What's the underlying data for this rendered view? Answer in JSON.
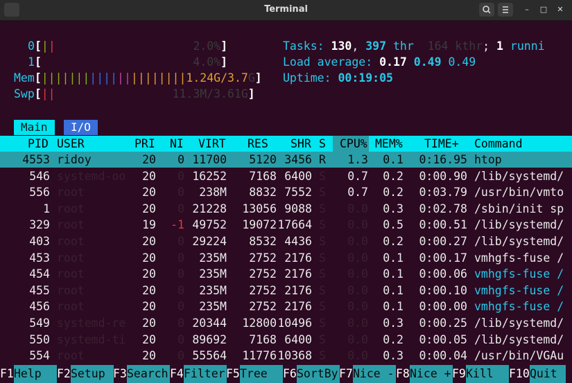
{
  "window": {
    "title": "Terminal"
  },
  "meters": {
    "cpu0": {
      "label": "0",
      "value": "2.0%"
    },
    "cpu1": {
      "label": "1",
      "value": "4.0%"
    },
    "mem": {
      "label": "Mem",
      "value": "1.24G/3.7",
      "value_tail": "G"
    },
    "swp": {
      "label": "Swp",
      "value": "11.3M/3.61G"
    }
  },
  "info": {
    "tasks_label": "Tasks:",
    "tasks": "130",
    "thr": "397",
    "thr_label": "thr",
    "kthr": "164 kthr",
    "running": "1",
    "running_label": "runni",
    "load_label": "Load average:",
    "load1": "0.17",
    "load5": "0.49",
    "load15": "0.49",
    "uptime_label": "Uptime:",
    "uptime": "00:19:05"
  },
  "tabs": [
    "Main",
    "I/O"
  ],
  "columns": [
    "PID",
    "USER",
    "PRI",
    "NI",
    "VIRT",
    "RES",
    "SHR",
    "S",
    "CPU%",
    "MEM%",
    "TIME+",
    "Command"
  ],
  "processes": [
    {
      "pid": "4553",
      "user": "ridoy",
      "pri": "20",
      "ni": "0",
      "virt": "11700",
      "res": "5120",
      "shr": "3456",
      "s": "R",
      "cpu": "1.3",
      "mem": "0.1",
      "time": "0:16.95",
      "cmd": "htop"
    },
    {
      "pid": "546",
      "user": "systemd-oo",
      "pri": "20",
      "ni": "0",
      "virt": "16252",
      "res": "7168",
      "shr": "6400",
      "s": "S",
      "cpu": "0.7",
      "mem": "0.2",
      "time": "0:00.90",
      "cmd": "/lib/systemd/"
    },
    {
      "pid": "556",
      "user": "root",
      "pri": "20",
      "ni": "0",
      "virt": "238M",
      "res": "8832",
      "shr": "7552",
      "s": "S",
      "cpu": "0.7",
      "mem": "0.2",
      "time": "0:03.79",
      "cmd": "/usr/bin/vmto"
    },
    {
      "pid": "1",
      "user": "root",
      "pri": "20",
      "ni": "0",
      "virt": "21228",
      "res": "13056",
      "shr": "9088",
      "s": "S",
      "cpu": "0.0",
      "mem": "0.3",
      "time": "0:02.78",
      "cmd": "/sbin/init sp"
    },
    {
      "pid": "329",
      "user": "root",
      "pri": "19",
      "ni": "-1",
      "virt": "49752",
      "res": "19072",
      "shr": "17664",
      "s": "S",
      "cpu": "0.0",
      "mem": "0.5",
      "time": "0:00.51",
      "cmd": "/lib/systemd/"
    },
    {
      "pid": "403",
      "user": "root",
      "pri": "20",
      "ni": "0",
      "virt": "29224",
      "res": "8532",
      "shr": "4436",
      "s": "S",
      "cpu": "0.0",
      "mem": "0.2",
      "time": "0:00.27",
      "cmd": "/lib/systemd/"
    },
    {
      "pid": "453",
      "user": "root",
      "pri": "20",
      "ni": "0",
      "virt": "235M",
      "res": "2752",
      "shr": "2176",
      "s": "S",
      "cpu": "0.0",
      "mem": "0.1",
      "time": "0:00.17",
      "cmd": "vmhgfs-fuse /"
    },
    {
      "pid": "454",
      "user": "root",
      "pri": "20",
      "ni": "0",
      "virt": "235M",
      "res": "2752",
      "shr": "2176",
      "s": "S",
      "cpu": "0.0",
      "mem": "0.1",
      "time": "0:00.06",
      "cmd": "vmhgfs-fuse /"
    },
    {
      "pid": "455",
      "user": "root",
      "pri": "20",
      "ni": "0",
      "virt": "235M",
      "res": "2752",
      "shr": "2176",
      "s": "S",
      "cpu": "0.0",
      "mem": "0.1",
      "time": "0:00.10",
      "cmd": "vmhgfs-fuse /"
    },
    {
      "pid": "456",
      "user": "root",
      "pri": "20",
      "ni": "0",
      "virt": "235M",
      "res": "2752",
      "shr": "2176",
      "s": "S",
      "cpu": "0.0",
      "mem": "0.1",
      "time": "0:00.00",
      "cmd": "vmhgfs-fuse /"
    },
    {
      "pid": "549",
      "user": "systemd-re",
      "pri": "20",
      "ni": "0",
      "virt": "20344",
      "res": "12800",
      "shr": "10496",
      "s": "S",
      "cpu": "0.0",
      "mem": "0.3",
      "time": "0:00.25",
      "cmd": "/lib/systemd/"
    },
    {
      "pid": "550",
      "user": "systemd-ti",
      "pri": "20",
      "ni": "0",
      "virt": "89692",
      "res": "7168",
      "shr": "6400",
      "s": "S",
      "cpu": "0.0",
      "mem": "0.2",
      "time": "0:00.05",
      "cmd": "/lib/systemd/"
    },
    {
      "pid": "554",
      "user": "root",
      "pri": "20",
      "ni": "0",
      "virt": "55564",
      "res": "11776",
      "shr": "10368",
      "s": "S",
      "cpu": "0.0",
      "mem": "0.3",
      "time": "0:00.04",
      "cmd": "/usr/bin/VGAu"
    }
  ],
  "footer": [
    {
      "key": "F1",
      "label": "Help"
    },
    {
      "key": "F2",
      "label": "Setup"
    },
    {
      "key": "F3",
      "label": "Search"
    },
    {
      "key": "F4",
      "label": "Filter"
    },
    {
      "key": "F5",
      "label": "Tree"
    },
    {
      "key": "F6",
      "label": "SortBy"
    },
    {
      "key": "F7",
      "label": "Nice -"
    },
    {
      "key": "F8",
      "label": "Nice +"
    },
    {
      "key": "F9",
      "label": "Kill"
    },
    {
      "key": "F10",
      "label": "Quit"
    }
  ]
}
